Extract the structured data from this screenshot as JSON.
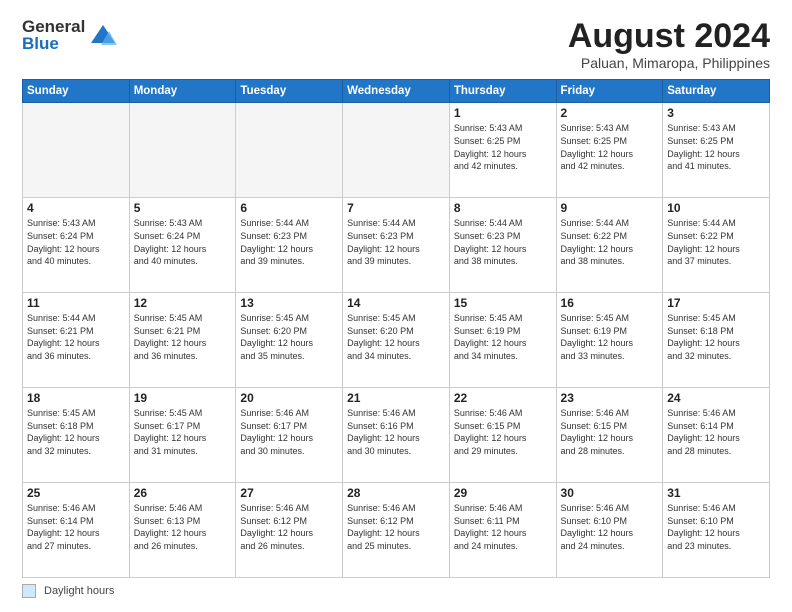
{
  "logo": {
    "general": "General",
    "blue": "Blue"
  },
  "title": "August 2024",
  "subtitle": "Paluan, Mimaropa, Philippines",
  "days_of_week": [
    "Sunday",
    "Monday",
    "Tuesday",
    "Wednesday",
    "Thursday",
    "Friday",
    "Saturday"
  ],
  "footer_label": "Daylight hours",
  "weeks": [
    [
      {
        "day": "",
        "info": ""
      },
      {
        "day": "",
        "info": ""
      },
      {
        "day": "",
        "info": ""
      },
      {
        "day": "",
        "info": ""
      },
      {
        "day": "1",
        "info": "Sunrise: 5:43 AM\nSunset: 6:25 PM\nDaylight: 12 hours\nand 42 minutes."
      },
      {
        "day": "2",
        "info": "Sunrise: 5:43 AM\nSunset: 6:25 PM\nDaylight: 12 hours\nand 42 minutes."
      },
      {
        "day": "3",
        "info": "Sunrise: 5:43 AM\nSunset: 6:25 PM\nDaylight: 12 hours\nand 41 minutes."
      }
    ],
    [
      {
        "day": "4",
        "info": "Sunrise: 5:43 AM\nSunset: 6:24 PM\nDaylight: 12 hours\nand 40 minutes."
      },
      {
        "day": "5",
        "info": "Sunrise: 5:43 AM\nSunset: 6:24 PM\nDaylight: 12 hours\nand 40 minutes."
      },
      {
        "day": "6",
        "info": "Sunrise: 5:44 AM\nSunset: 6:23 PM\nDaylight: 12 hours\nand 39 minutes."
      },
      {
        "day": "7",
        "info": "Sunrise: 5:44 AM\nSunset: 6:23 PM\nDaylight: 12 hours\nand 39 minutes."
      },
      {
        "day": "8",
        "info": "Sunrise: 5:44 AM\nSunset: 6:23 PM\nDaylight: 12 hours\nand 38 minutes."
      },
      {
        "day": "9",
        "info": "Sunrise: 5:44 AM\nSunset: 6:22 PM\nDaylight: 12 hours\nand 38 minutes."
      },
      {
        "day": "10",
        "info": "Sunrise: 5:44 AM\nSunset: 6:22 PM\nDaylight: 12 hours\nand 37 minutes."
      }
    ],
    [
      {
        "day": "11",
        "info": "Sunrise: 5:44 AM\nSunset: 6:21 PM\nDaylight: 12 hours\nand 36 minutes."
      },
      {
        "day": "12",
        "info": "Sunrise: 5:45 AM\nSunset: 6:21 PM\nDaylight: 12 hours\nand 36 minutes."
      },
      {
        "day": "13",
        "info": "Sunrise: 5:45 AM\nSunset: 6:20 PM\nDaylight: 12 hours\nand 35 minutes."
      },
      {
        "day": "14",
        "info": "Sunrise: 5:45 AM\nSunset: 6:20 PM\nDaylight: 12 hours\nand 34 minutes."
      },
      {
        "day": "15",
        "info": "Sunrise: 5:45 AM\nSunset: 6:19 PM\nDaylight: 12 hours\nand 34 minutes."
      },
      {
        "day": "16",
        "info": "Sunrise: 5:45 AM\nSunset: 6:19 PM\nDaylight: 12 hours\nand 33 minutes."
      },
      {
        "day": "17",
        "info": "Sunrise: 5:45 AM\nSunset: 6:18 PM\nDaylight: 12 hours\nand 32 minutes."
      }
    ],
    [
      {
        "day": "18",
        "info": "Sunrise: 5:45 AM\nSunset: 6:18 PM\nDaylight: 12 hours\nand 32 minutes."
      },
      {
        "day": "19",
        "info": "Sunrise: 5:45 AM\nSunset: 6:17 PM\nDaylight: 12 hours\nand 31 minutes."
      },
      {
        "day": "20",
        "info": "Sunrise: 5:46 AM\nSunset: 6:17 PM\nDaylight: 12 hours\nand 30 minutes."
      },
      {
        "day": "21",
        "info": "Sunrise: 5:46 AM\nSunset: 6:16 PM\nDaylight: 12 hours\nand 30 minutes."
      },
      {
        "day": "22",
        "info": "Sunrise: 5:46 AM\nSunset: 6:15 PM\nDaylight: 12 hours\nand 29 minutes."
      },
      {
        "day": "23",
        "info": "Sunrise: 5:46 AM\nSunset: 6:15 PM\nDaylight: 12 hours\nand 28 minutes."
      },
      {
        "day": "24",
        "info": "Sunrise: 5:46 AM\nSunset: 6:14 PM\nDaylight: 12 hours\nand 28 minutes."
      }
    ],
    [
      {
        "day": "25",
        "info": "Sunrise: 5:46 AM\nSunset: 6:14 PM\nDaylight: 12 hours\nand 27 minutes."
      },
      {
        "day": "26",
        "info": "Sunrise: 5:46 AM\nSunset: 6:13 PM\nDaylight: 12 hours\nand 26 minutes."
      },
      {
        "day": "27",
        "info": "Sunrise: 5:46 AM\nSunset: 6:12 PM\nDaylight: 12 hours\nand 26 minutes."
      },
      {
        "day": "28",
        "info": "Sunrise: 5:46 AM\nSunset: 6:12 PM\nDaylight: 12 hours\nand 25 minutes."
      },
      {
        "day": "29",
        "info": "Sunrise: 5:46 AM\nSunset: 6:11 PM\nDaylight: 12 hours\nand 24 minutes."
      },
      {
        "day": "30",
        "info": "Sunrise: 5:46 AM\nSunset: 6:10 PM\nDaylight: 12 hours\nand 24 minutes."
      },
      {
        "day": "31",
        "info": "Sunrise: 5:46 AM\nSunset: 6:10 PM\nDaylight: 12 hours\nand 23 minutes."
      }
    ]
  ]
}
